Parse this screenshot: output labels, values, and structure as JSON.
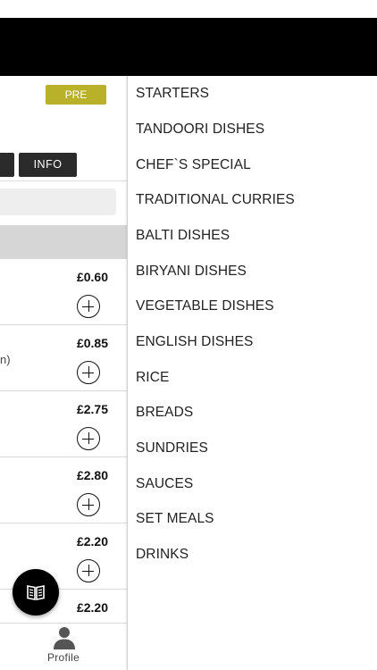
{
  "header": {
    "background": "#000000"
  },
  "restaurant": {
    "preorder_label": "PRE ORDER",
    "tabs": [
      {
        "label": ""
      },
      {
        "label": "INFO"
      }
    ]
  },
  "menu_items": [
    {
      "price": "£0.60",
      "snippet": ""
    },
    {
      "price": "£0.85",
      "snippet": "n)"
    },
    {
      "price": "£2.75",
      "snippet": ""
    },
    {
      "price": "£2.80",
      "snippet": ""
    },
    {
      "price": "£2.20",
      "snippet": ""
    },
    {
      "price": "£2.20",
      "snippet": ""
    }
  ],
  "fab": {
    "icon": "menu-book-icon"
  },
  "bottom_nav": {
    "profile_label": "Profile",
    "profile_icon": "person-icon"
  },
  "categories": [
    "STARTERS",
    "TANDOORI DISHES",
    "CHEF`S SPECIAL",
    "TRADITIONAL CURRIES",
    "BALTI DISHES",
    "BIRYANI DISHES",
    "VEGETABLE DISHES",
    "ENGLISH DISHES",
    "RICE",
    "BREADS",
    "SUNDRIES",
    "SAUCES",
    "SET MEALS",
    "DRINKS"
  ],
  "colors": {
    "preorder_badge": "#b9b12a",
    "tab_button": "#2b2b2b"
  }
}
